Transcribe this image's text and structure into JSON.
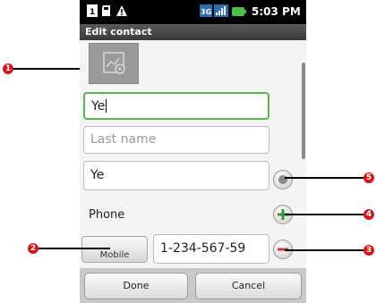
{
  "status_bar": {
    "time": "5:03 PM",
    "icons": [
      "sim-icon",
      "sd-card-icon",
      "warning-icon",
      "3g-icon",
      "signal-icon",
      "battery-icon"
    ]
  },
  "title": "Edit contact",
  "contact_photo": {
    "icon": "contact-photo-icon"
  },
  "fields": {
    "first_name": {
      "value": "Ye"
    },
    "last_name": {
      "placeholder": "Last name"
    },
    "display_name": {
      "value": "Ye"
    }
  },
  "phone_section": {
    "label": "Phone",
    "type_label": "Mobile",
    "number": "1-234-567-59"
  },
  "buttons": {
    "done": "Done",
    "cancel": "Cancel"
  },
  "callouts": {
    "photo": "1",
    "type": "2",
    "remove": "3",
    "add": "4",
    "expand": "5"
  },
  "colors": {
    "focus": "#5ab54a",
    "callout": "#d9141b",
    "add": "#2f9a2f",
    "remove": "#d23a3a"
  }
}
